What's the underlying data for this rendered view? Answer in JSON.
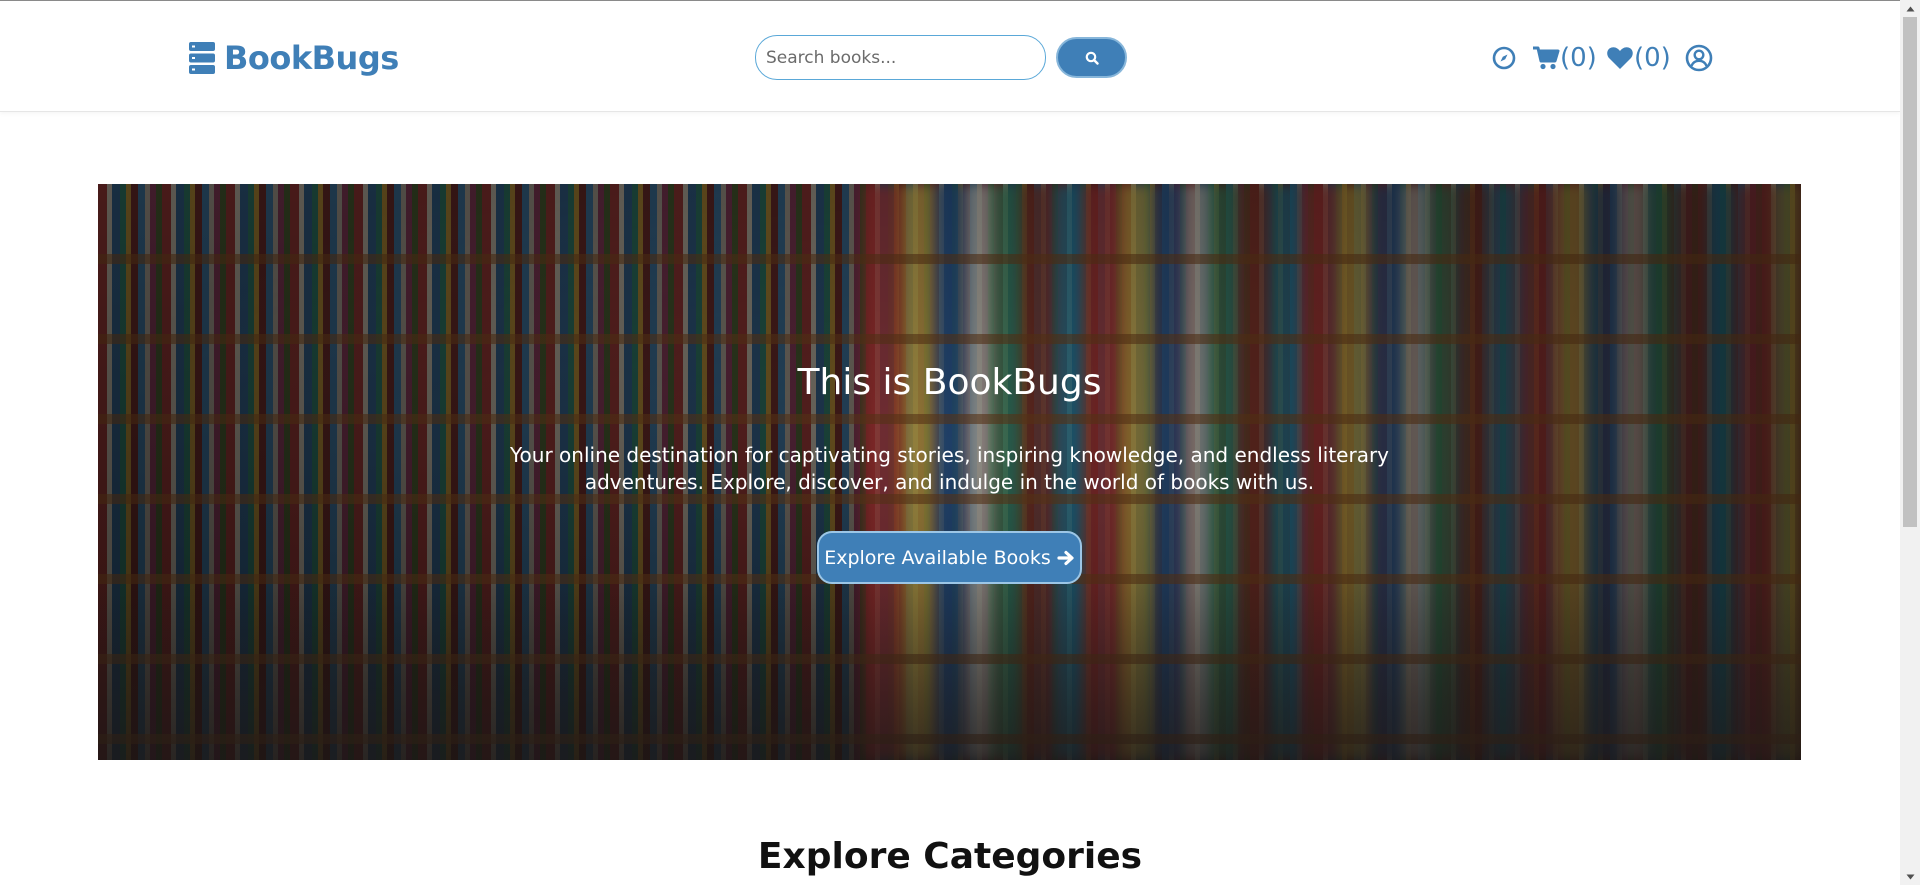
{
  "header": {
    "logo_text": "BookBugs",
    "search": {
      "placeholder": "Search books..."
    },
    "cart_count": "(0)",
    "wishlist_count": "(0)",
    "icons": [
      "compass-icon",
      "cart-icon",
      "heart-icon",
      "user-icon",
      "search-icon"
    ]
  },
  "hero": {
    "title": "This is BookBugs",
    "subtitle": "Your online destination for captivating stories, inspiring knowledge, and endless literary adventures. Explore, discover, and indulge in the world of books with us.",
    "button_label": "Explore Available Books"
  },
  "sections": {
    "categories_title": "Explore Categories"
  },
  "colors": {
    "brand": "#3f7fb7",
    "search_border": "#5aa8d8",
    "text_dark": "#111111"
  }
}
